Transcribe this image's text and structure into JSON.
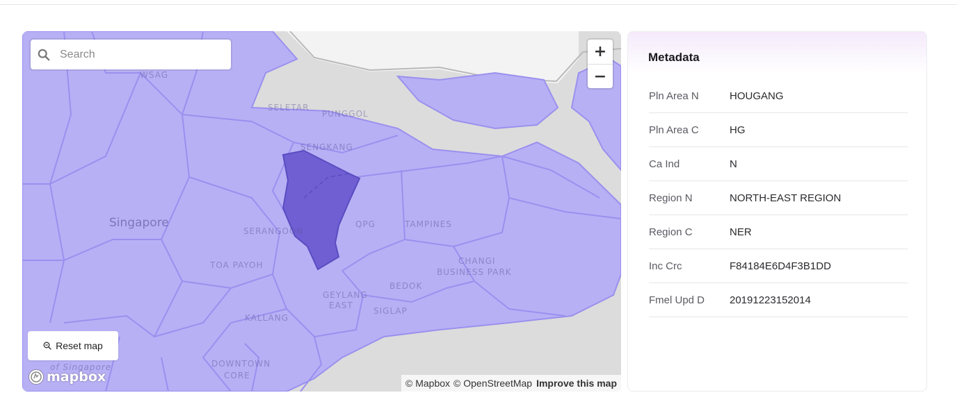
{
  "map": {
    "search_placeholder": "Search",
    "zoom_in": "+",
    "zoom_out": "−",
    "reset_label": "Reset map",
    "logo_text": "mapbox",
    "attribution": {
      "mapbox": "© Mapbox",
      "osm": "© OpenStreetMap",
      "improve": "Improve this map"
    },
    "labels": {
      "wsag": "WSAG",
      "seletar": "SELETAR",
      "punggol": "PUNGGOL",
      "sengkang": "SENGKANG",
      "singapore": "Singapore",
      "serangoon": "SERANGOON",
      "qpg": "QPG",
      "tampines": "TAMPINES",
      "toa_payoh": "TOA PAYOH",
      "changi_1": "CHANGI",
      "changi_2": "BUSINESS PARK",
      "bedok": "BEDOK",
      "geylang_1": "GEYLANG",
      "geylang_2": "EAST",
      "siglap": "SIGLAP",
      "kallang": "KALLANG",
      "downtown_1": "DOWNTOWN",
      "downtown_2": "CORE",
      "strait": "of Singapore"
    },
    "colors": {
      "region_fill": "#b7b0f5",
      "selected_fill": "#6f5fd3",
      "water": "#dcdcdc",
      "land": "#f4f4f4"
    }
  },
  "metadata": {
    "title": "Metadata",
    "rows": [
      {
        "key": "Pln Area N",
        "value": "HOUGANG"
      },
      {
        "key": "Pln Area C",
        "value": "HG"
      },
      {
        "key": "Ca Ind",
        "value": "N"
      },
      {
        "key": "Region N",
        "value": "NORTH-EAST REGION"
      },
      {
        "key": "Region C",
        "value": "NER"
      },
      {
        "key": "Inc Crc",
        "value": "F84184E6D4F3B1DD"
      },
      {
        "key": "Fmel Upd D",
        "value": "20191223152014"
      }
    ]
  }
}
